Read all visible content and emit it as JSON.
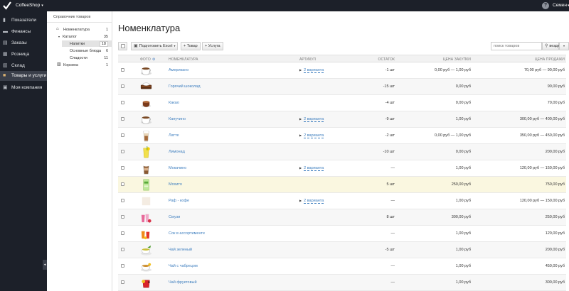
{
  "topbar": {
    "app_name": "CoffeeShop",
    "user_name": "Семен",
    "help_label": "?"
  },
  "nav": {
    "items": [
      {
        "label": "Показатели",
        "icon": "bar-chart-icon"
      },
      {
        "label": "Финансы",
        "icon": "money-icon"
      },
      {
        "label": "Заказы",
        "icon": "cart-icon"
      },
      {
        "label": "Розница",
        "icon": "store-icon"
      },
      {
        "label": "Склад",
        "icon": "warehouse-icon"
      },
      {
        "label": "Товары и услуги",
        "icon": "box-icon"
      },
      {
        "label": "Моя компания",
        "icon": "company-icon"
      }
    ],
    "collapse_label": "◂"
  },
  "tree": {
    "title": "Справочник товаров",
    "items": [
      {
        "label": "Номенклатура",
        "count": "1",
        "icon": "home-icon"
      },
      {
        "label": "Каталог",
        "count": "35",
        "icon": "expand-toggle-icon"
      },
      {
        "label": "Напитки",
        "count": "18"
      },
      {
        "label": "Основные блюда",
        "count": "6"
      },
      {
        "label": "Сладости",
        "count": "11"
      },
      {
        "label": "Корзина",
        "count": "1",
        "icon": "trash-icon"
      }
    ]
  },
  "main": {
    "title": "Номенклатура",
    "toolbar": {
      "export_label": "Подготовить Excel",
      "add_product_label": "+ Товар",
      "add_service_label": "+ Услуга",
      "search_placeholder": "поиск товаров",
      "search_scope_label": "везде"
    },
    "columns": {
      "photo": "ФОТО",
      "name": "НОМЕНКЛАТУРА",
      "article": "АРТИКУЛ",
      "stock": "ОСТАТОК",
      "purchase": "ЦЕНА ЗАКУПКИ",
      "sale": "ЦЕНА ПРОДАЖИ"
    },
    "rows": [
      {
        "name": "Американо",
        "variants": "2 варианта",
        "stock": "-1 шт",
        "purchase": "0,00 руб — 1,00 руб",
        "sale": "70,00 руб — 90,00 руб",
        "photo": "cup"
      },
      {
        "name": "Горячий шоколад",
        "variants": "",
        "stock": "-15 шт",
        "purchase": "0,00 руб",
        "sale": "90,00 руб",
        "photo": "chocolate"
      },
      {
        "name": "Какао",
        "variants": "",
        "stock": "-4 шт",
        "purchase": "0,00 руб",
        "sale": "70,00 руб",
        "photo": "cocoa"
      },
      {
        "name": "Капучино",
        "variants": "2 варианта",
        "stock": "-9 шт",
        "purchase": "1,00 руб",
        "sale": "300,00 руб — 400,00 руб",
        "photo": "cup"
      },
      {
        "name": "Латте",
        "variants": "2 варианта",
        "stock": "-2 шт",
        "purchase": "0,00 руб — 1,00 руб",
        "sale": "350,00 руб — 450,00 руб",
        "photo": "glass"
      },
      {
        "name": "Лимонад",
        "variants": "",
        "stock": "-10 шт",
        "purchase": "0,00 руб",
        "sale": "200,00 руб",
        "photo": "lemon"
      },
      {
        "name": "Мокачино",
        "variants": "2 варианта",
        "stock": "—",
        "purchase": "1,00 руб",
        "sale": "120,00 руб — 150,00 руб",
        "photo": "mocha"
      },
      {
        "name": "Мохито",
        "variants": "",
        "stock": "5 шт",
        "purchase": "250,00 руб",
        "sale": "750,00 руб",
        "photo": "mojito"
      },
      {
        "name": "Раф - кофе",
        "variants": "2 варианта",
        "stock": "—",
        "purchase": "1,00 руб",
        "sale": "120,00 руб — 150,00 руб",
        "photo": "raf"
      },
      {
        "name": "Смузи",
        "variants": "",
        "stock": "8 шт",
        "purchase": "300,00 руб",
        "sale": "250,00 руб",
        "photo": "smoothie"
      },
      {
        "name": "Сок в ассортименте",
        "variants": "",
        "stock": "—",
        "purchase": "1,00 руб",
        "sale": "120,00 руб",
        "photo": "juice"
      },
      {
        "name": "Чай зеленый",
        "variants": "",
        "stock": "-5 шт",
        "purchase": "1,00 руб",
        "sale": "200,00 руб",
        "photo": "greentea"
      },
      {
        "name": "Чай с чабрецом",
        "variants": "",
        "stock": "—",
        "purchase": "1,00 руб",
        "sale": "450,00 руб",
        "photo": "herbtea"
      },
      {
        "name": "Чай фруктовый",
        "variants": "",
        "stock": "—",
        "purchase": "1,00 руб",
        "sale": "300,00 руб",
        "photo": "fruittea"
      }
    ]
  }
}
